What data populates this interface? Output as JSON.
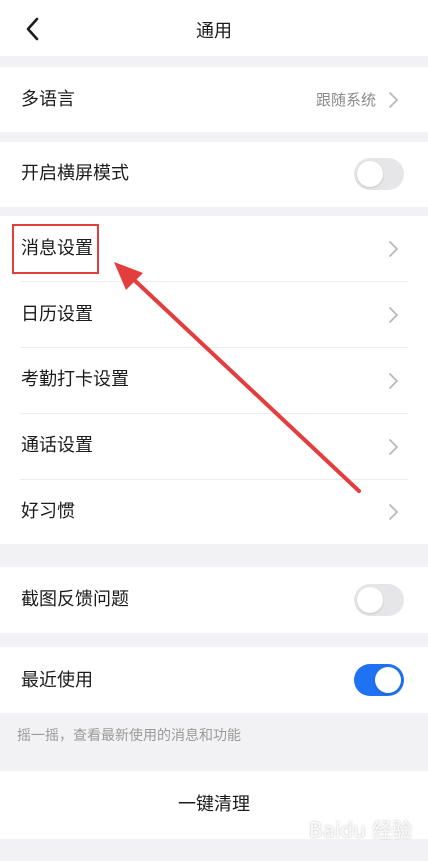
{
  "header": {
    "title": "通用",
    "back_icon": "chevron-left-icon"
  },
  "language": {
    "label": "多语言",
    "value": "跟随系统"
  },
  "landscape": {
    "label": "开启横屏模式",
    "enabled": false
  },
  "settings_list": [
    {
      "label": "消息设置"
    },
    {
      "label": "日历设置"
    },
    {
      "label": "考勤打卡设置"
    },
    {
      "label": "通话设置"
    },
    {
      "label": "好习惯"
    }
  ],
  "screenshot_feedback": {
    "label": "截图反馈问题",
    "enabled": false
  },
  "recent_use": {
    "label": "最近使用",
    "enabled": true
  },
  "hint": "摇一摇，查看最新使用的消息和功能",
  "clear_button": {
    "label": "一键清理"
  },
  "watermark": "Baidu 经验",
  "colors": {
    "accent": "#1f72f2",
    "annotation": "#e43d3d",
    "background": "#f2f2f4"
  }
}
